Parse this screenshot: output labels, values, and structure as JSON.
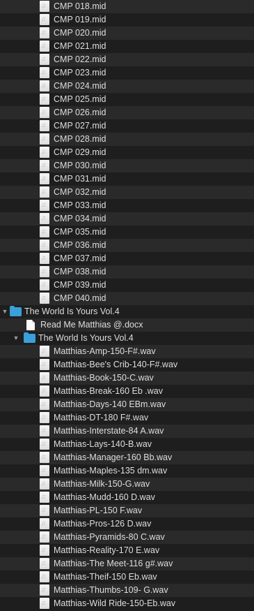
{
  "files_top": [
    "CMP 018.mid",
    "CMP 019.mid",
    "CMP 020.mid",
    "CMP 021.mid",
    "CMP 022.mid",
    "CMP 023.mid",
    "CMP 024.mid",
    "CMP 025.mid",
    "CMP 026.mid",
    "CMP 027.mid",
    "CMP 028.mid",
    "CMP 029.mid",
    "CMP 030.mid",
    "CMP 031.mid",
    "CMP 032.mid",
    "CMP 033.mid",
    "CMP 034.mid",
    "CMP 035.mid",
    "CMP 036.mid",
    "CMP 037.mid",
    "CMP 038.mid",
    "CMP 039.mid",
    "CMP 040.mid"
  ],
  "folder_main": {
    "name": "The World Is Yours Vol.4",
    "icon": "folder-icon",
    "expanded": true
  },
  "doc_file": {
    "name": "Read Me Matthias @.docx",
    "icon": "document-icon"
  },
  "folder_sub": {
    "name": "The World Is Yours Vol.4",
    "icon": "folder-icon",
    "expanded": true
  },
  "files_sub": [
    "Matthias-Amp-150-F#.wav",
    "Matthias-Bee's Crib-140-F#.wav",
    "Matthias-Book-150-C.wav",
    "Matthias-Break-160 Eb .wav",
    "Matthias-Days-140 EBm.wav",
    "Matthias-DT-180 F#.wav",
    "Matthias-Interstate-84 A.wav",
    "Matthias-Lays-140-B.wav",
    "Matthias-Manager-160 Bb.wav",
    "Matthias-Maples-135 dm.wav",
    "Matthias-Milk-150-G.wav",
    "Matthias-Mudd-160 D.wav",
    "Matthias-PL-150 F.wav",
    "Matthias-Pros-126 D.wav",
    "Matthias-Pyramids-80  C.wav",
    "Matthias-Reality-170 E.wav",
    "Matthias-The Meet-116 g#.wav",
    "Matthias-Theif-150 Eb.wav",
    "Matthias-Thumbs-109- G.wav",
    "Matthias-Wild Ride-150-Eb.wav"
  ],
  "colors": {
    "background": "#1e1e1e",
    "row_alt": "#2a2a2a",
    "text": "#dedede",
    "folder": "#3aa0dc"
  }
}
